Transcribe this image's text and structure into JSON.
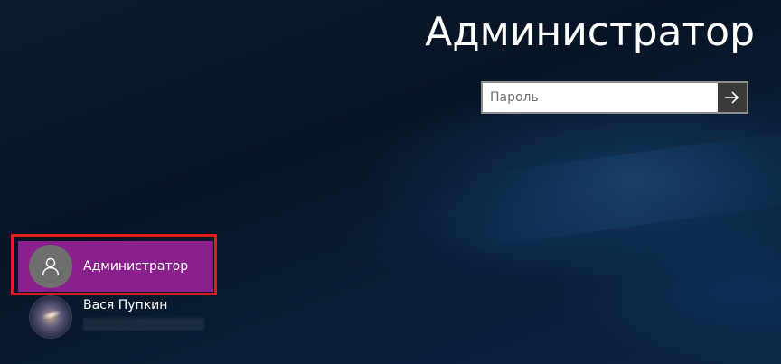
{
  "login": {
    "title": "Администратор",
    "password_placeholder": "Пароль",
    "password_value": "",
    "submit_icon": "arrow-right-icon"
  },
  "users": [
    {
      "name": "Администратор",
      "avatar": "user-icon",
      "selected": true
    },
    {
      "name": "Вася Пупкин",
      "avatar": "galaxy-avatar",
      "selected": false
    }
  ],
  "colors": {
    "selected_tile": "#8a1f8e",
    "highlight_frame": "#e31d1d",
    "background": "#071426",
    "submit_button": "#3a3a3a"
  }
}
